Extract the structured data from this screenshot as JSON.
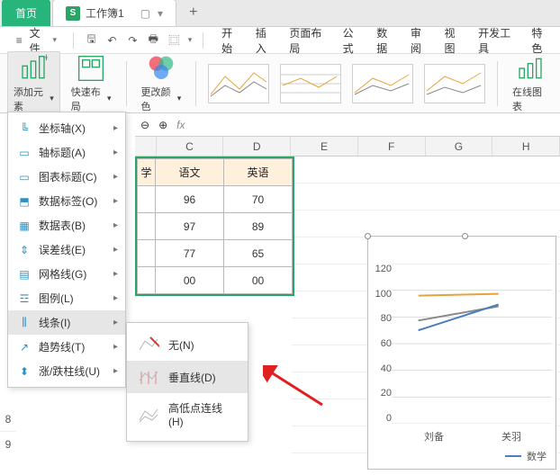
{
  "top": {
    "home": "首页",
    "workbook": "工作簿1",
    "plus": "+"
  },
  "filebar": {
    "file": "文件",
    "ribbon_tabs": [
      "开始",
      "插入",
      "页面布局",
      "公式",
      "数据",
      "审阅",
      "视图",
      "开发工具",
      "特色"
    ]
  },
  "ribbon": {
    "add_elem": "添加元素",
    "quick_layout": "快速布局",
    "change_color": "更改颜色",
    "online_chart": "在线图表"
  },
  "dropdown": {
    "items": [
      {
        "label": "坐标轴(X)"
      },
      {
        "label": "轴标题(A)"
      },
      {
        "label": "图表标题(C)"
      },
      {
        "label": "数据标签(O)"
      },
      {
        "label": "数据表(B)"
      },
      {
        "label": "误差线(E)"
      },
      {
        "label": "网格线(G)"
      },
      {
        "label": "图例(L)"
      },
      {
        "label": "线条(I)"
      },
      {
        "label": "趋势线(T)"
      },
      {
        "label": "涨/跌柱线(U)"
      }
    ]
  },
  "submenu": {
    "none": "无(N)",
    "vertical": "垂直线(D)",
    "hilo": "高低点连线(H)"
  },
  "formula": {
    "zoom": "⊖ ⊕",
    "fx": "fx"
  },
  "cols": [
    "C",
    "D",
    "E",
    "F",
    "G",
    "H"
  ],
  "row_labels": [
    "8",
    "9"
  ],
  "table": {
    "head_cut": "学",
    "head2": "语文",
    "head3": "英语",
    "rows": [
      [
        "",
        "96",
        "70"
      ],
      [
        "",
        "97",
        "89"
      ],
      [
        "",
        "77",
        "65"
      ],
      [
        "",
        "00",
        "00"
      ]
    ]
  },
  "chart_data": {
    "type": "line",
    "categories": [
      "刘备",
      "关羽"
    ],
    "series": [
      {
        "name": "数学",
        "values": [
          96,
          97
        ],
        "color": "#e8a23a"
      },
      {
        "name": "语文",
        "values": [
          77,
          88
        ],
        "color": "#4a7cc0"
      },
      {
        "name": "英语",
        "values": [
          70,
          89
        ],
        "color": "#8a8a8a"
      }
    ],
    "ylim": [
      0,
      120
    ],
    "yticks": [
      0,
      20,
      40,
      60,
      80,
      100,
      120
    ],
    "legend_visible": "数学"
  }
}
